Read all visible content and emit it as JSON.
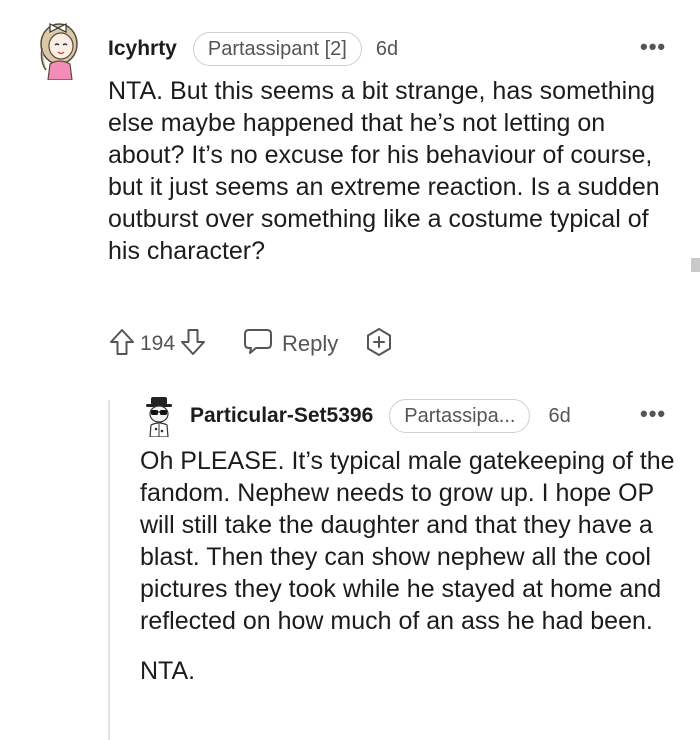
{
  "comment": {
    "username": "Icyhrty",
    "flair": "Partassipant [2]",
    "time": "6d",
    "more": "•••",
    "body": "NTA. But this seems a bit strange, has something else maybe happened that he’s not letting on about? It’s no excuse for his behaviour of course, but it just seems an extreme reaction. Is a sudden outburst over something like a costume typical of his character?",
    "votes": "194",
    "reply_label": "Reply",
    "icons": {
      "upvote": "upvote-arrow-icon",
      "downvote": "downvote-arrow-icon",
      "reply": "speech-bubble-icon",
      "award": "award-plus-icon",
      "avatar": "girl-avatar-icon"
    }
  },
  "reply": {
    "username": "Particular-Set5396",
    "flair": "Partassipa...",
    "time": "6d",
    "more": "•••",
    "paragraphs": [
      "Oh PLEASE. It’s typical male gatekeeping of the fandom. Nephew needs to grow up. I hope OP will still take the daughter and that they have a blast. Then they can show nephew all the cool pictures they took while he stayed at home and reflected on how much of an ass he had been.",
      "NTA."
    ],
    "icons": {
      "avatar": "hat-sunglasses-avatar-icon"
    }
  },
  "colors": {
    "text": "#1c1c1c",
    "meta": "#555555",
    "flair_border": "#cfcfcf",
    "thread_line": "#e2e2e2"
  }
}
